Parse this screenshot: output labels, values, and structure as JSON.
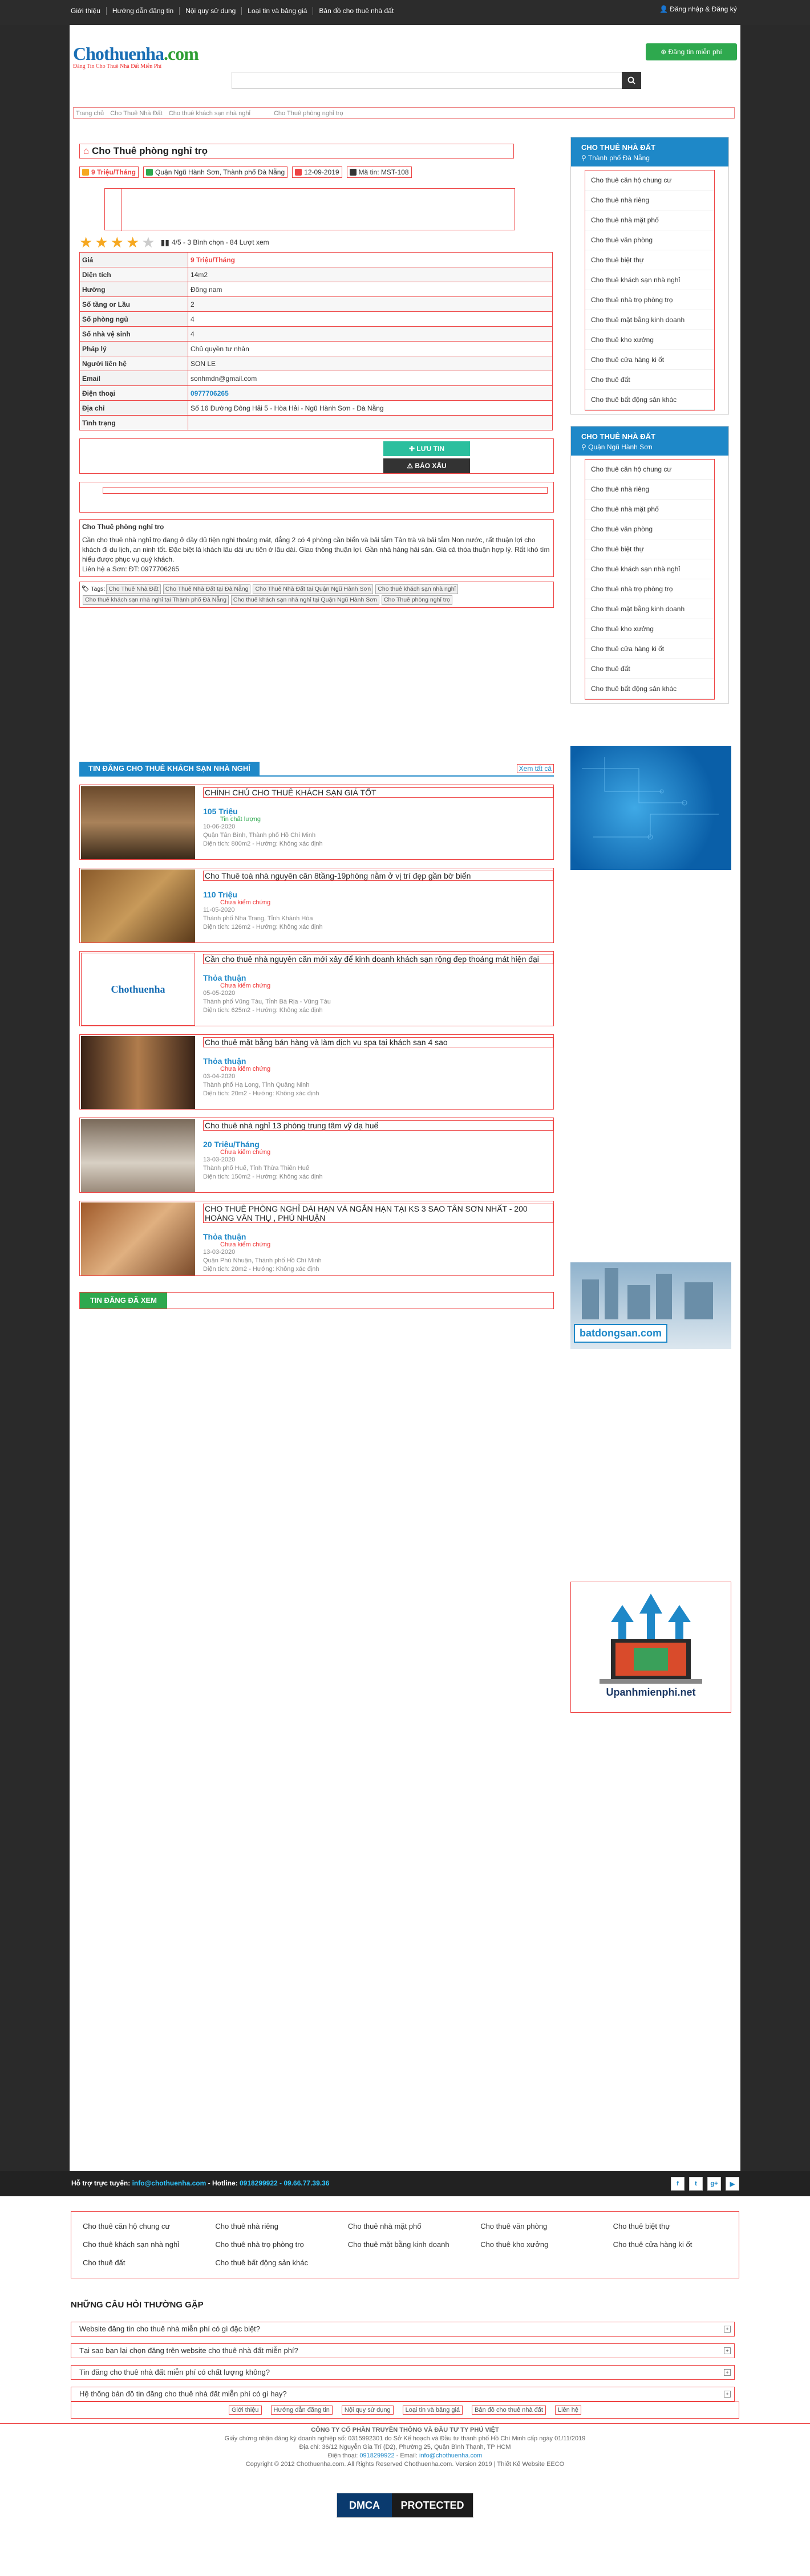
{
  "topbar": {
    "links": [
      "Giới thiệu",
      "Hướng dẫn đăng tin",
      "Nội quy sử dụng",
      "Loại tin và bảng giá",
      "Bản đồ cho thuê nhà đất"
    ],
    "login": "Đăng nhập & Đăng ký"
  },
  "header": {
    "logo_main": "Chothuenha",
    "logo_tld": ".com",
    "logo_slogan": "Đăng Tin Cho Thuê Nhà Đất Miễn Phí",
    "post_button": "Đăng tin miễn phí",
    "search_placeholder": ""
  },
  "breadcrumb": [
    "Trang chủ",
    "Cho Thuê Nhà Đất",
    "Cho thuê khách sạn nhà nghỉ",
    "Cho Thuê phòng nghỉ trọ"
  ],
  "listing": {
    "title": "Cho Thuê phòng nghỉ trọ",
    "price_tag": "9 Triệu/Tháng",
    "location_tag": "Quận Ngũ Hành Sơn, Thành phố Đà Nẵng",
    "date_tag": "12-09-2019",
    "code_tag": "Mã tin: MST-108",
    "rating_text": "4/5 - 3 Bình chọn - 84 Lượt xem",
    "rating_value": 4,
    "info_rows": [
      {
        "label": "Giá",
        "value": "9 Triệu/Tháng"
      },
      {
        "label": "Diện tích",
        "value": "14m2"
      },
      {
        "label": "Hướng",
        "value": "Đông nam"
      },
      {
        "label": "Số tầng or Lầu",
        "value": "2"
      },
      {
        "label": "Số phòng ngủ",
        "value": "4"
      },
      {
        "label": "Số nhà vệ sinh",
        "value": "4"
      },
      {
        "label": "Pháp lý",
        "value": "Chủ quyền tư nhân"
      },
      {
        "label": "Người liên hệ",
        "value": "SON LE"
      },
      {
        "label": "Email",
        "value": "sonhmdn@gmail.com"
      },
      {
        "label": "Điện thoại",
        "value": "0977706265"
      },
      {
        "label": "Địa chỉ",
        "value": "Số 16 Đường Đông Hải 5 - Hòa Hải - Ngũ Hành Sơn - Đà Nẵng"
      },
      {
        "label": "Tình trạng",
        "value": ""
      }
    ],
    "save_button": "LƯU TIN",
    "report_button": "BÁO XẤU",
    "desc_heading": "Cho Thuê phòng nghỉ trọ",
    "description": "Cần cho thuê nhà nghỉ trọ đang ở đầy đủ tiện nghi thoáng mát, đẳng 2 có 4 phòng cần biển và bãi tắm Tân trà và bãi tắm Non nước, rất thuận lợi cho khách đi du lịch, an ninh tốt. Đặc biệt là khách lâu dài ưu tiên ở lâu dài. Giao thông thuận lợi. Gần nhà hàng hải sản. Giá cả thỏa thuận hợp lý. Rất khó tìm hiểu được phục vụ quý khách.",
    "contact": "Liên hệ a Sơn: ĐT: 0977706265",
    "tags_label": "Tags:",
    "tags": [
      "Cho Thuê Nhà Đất",
      "Cho Thuê Nhà Đất tại Đà Nẵng",
      "Cho Thuê Nhà Đất tại Quận Ngũ Hành Sơn",
      "Cho thuê khách sạn nhà nghỉ",
      "Cho thuê khách sạn nhà nghỉ tại Thành phố Đà Nẵng",
      "Cho thuê khách sạn nhà nghỉ tại Quận Ngũ Hành Sơn",
      "Cho Thuê phòng nghỉ trọ"
    ]
  },
  "related": {
    "heading": "TIN ĐĂNG CHO THUÊ KHÁCH SẠN NHÀ NGHỈ",
    "more": "Xem tất cả",
    "items": [
      {
        "title": "CHÍNH CHỦ CHO THUÊ KHÁCH SẠN GIÁ TỐT",
        "price": "105 Triệu",
        "status": "Tin chất lượng",
        "date": "10-06-2020",
        "place": "Quận Tân Bình, Thành phố Hồ Chí Minh",
        "area": "Diện tích: 800m2 - Hướng: Không xác định",
        "thumb": "room"
      },
      {
        "title": "Cho Thuê toà nhà nguyên căn 8tầng-19phòng nằm ở vị trí đẹp gần bờ biển",
        "price": "110 Triệu",
        "status": "Chưa kiểm chứng",
        "date": "11-05-2020",
        "place": "Thành phố Nha Trang, Tỉnh Khánh Hòa",
        "area": "Diện tích: 126m2 - Hướng: Không xác định",
        "thumb": "room2"
      },
      {
        "title": "Cần cho thuê nhà nguyên căn mới xây để kinh doanh khách sạn rộng đẹp thoáng mát hiện đại",
        "price": "Thỏa thuận",
        "status": "Chưa kiểm chứng",
        "date": "05-05-2020",
        "place": "Thành phố Vũng Tàu, Tỉnh Bà Rịa - Vũng Tàu",
        "area": "Diện tích: 625m2 - Hướng: Không xác định",
        "thumb": "logo"
      },
      {
        "title": "Cho thuê mặt bằng bán hàng và làm dịch vụ spa tại khách sạn 4 sao",
        "price": "Thỏa thuận",
        "status": "Chưa kiểm chứng",
        "date": "03-04-2020",
        "place": "Thành phố Hạ Long, Tỉnh Quảng Ninh",
        "area": "Diện tích: 20m2 - Hướng: Không xác định",
        "thumb": "spa"
      },
      {
        "title": "Cho thuê nhà nghỉ 13 phòng trung tâm vỹ dạ huế",
        "price": "20 Triệu/Tháng",
        "status": "Chưa kiểm chứng",
        "date": "13-03-2020",
        "place": "Thành phố Huế, Tỉnh Thừa Thiên Huế",
        "area": "Diện tích: 150m2 - Hướng: Không xác định",
        "thumb": "bed"
      },
      {
        "title": "CHO THUÊ PHÒNG NGHỈ DÀI HẠN VÀ NGẮN HẠN TẠI KS 3 SAO TÂN SƠN NHẤT - 200 HOÀNG VĂN THỤ , PHÚ NHUẬN",
        "price": "Thỏa thuận",
        "status": "Chưa kiểm chứng",
        "date": "13-03-2020",
        "place": "Quận Phú Nhuận, Thành phố Hồ Chí Minh",
        "area": "Diện tích: 20m2 - Hướng: Không xác định",
        "thumb": "room3"
      }
    ],
    "viewed_heading": "TIN ĐĂNG ĐÃ XEM"
  },
  "sidebar": {
    "box1": {
      "title": "CHO THUÊ NHÀ ĐẤT",
      "sub": "Thành phố Đà Nẵng",
      "items": [
        "Cho thuê căn hộ chung cư",
        "Cho thuê nhà riêng",
        "Cho thuê nhà mặt phố",
        "Cho thuê văn phòng",
        "Cho thuê biệt thự",
        "Cho thuê khách sạn nhà nghỉ",
        "Cho thuê nhà trọ phòng trọ",
        "Cho thuê mặt bằng kinh doanh",
        "Cho thuê kho xưởng",
        "Cho thuê cửa hàng ki ốt",
        "Cho thuê đất",
        "Cho thuê bất động sản khác"
      ]
    },
    "box2": {
      "title": "CHO THUÊ NHÀ ĐẤT",
      "sub": "Quận Ngũ Hành Sơn",
      "items": [
        "Cho thuê căn hộ chung cư",
        "Cho thuê nhà riêng",
        "Cho thuê nhà mặt phố",
        "Cho thuê văn phòng",
        "Cho thuê biệt thự",
        "Cho thuê khách sạn nhà nghỉ",
        "Cho thuê nhà trọ phòng trọ",
        "Cho thuê mặt bằng kinh doanh",
        "Cho thuê kho xưởng",
        "Cho thuê cửa hàng ki ốt",
        "Cho thuê đất",
        "Cho thuê bất động sản khác"
      ]
    },
    "ad_batdongsan": "batdongsan.com",
    "ad_upanh": "Upanhmienphi.net"
  },
  "footer": {
    "support_label": "Hỗ trợ trực tuyến:",
    "support_email": "info@chothuenha.com",
    "hotline_label": "- Hotline:",
    "hotline": "0918299922 - 09.66.77.39.36",
    "social": [
      "f",
      "t",
      "g+",
      "▶"
    ],
    "categories": [
      "Cho thuê căn hộ chung cư",
      "Cho thuê nhà riêng",
      "Cho thuê nhà mặt phố",
      "Cho thuê văn phòng",
      "Cho thuê biệt thự",
      "Cho thuê khách sạn nhà nghỉ",
      "Cho thuê nhà trọ phòng trọ",
      "Cho thuê mặt bằng kinh doanh",
      "Cho thuê kho xưởng",
      "Cho thuê cửa hàng ki ốt",
      "Cho thuê đất",
      "Cho thuê bất động sản khác"
    ],
    "faq_heading": "NHỮNG CÂU HỎI THƯỜNG GẶP",
    "faq": [
      "Website đăng tin cho thuê nhà miễn phí có gì đặc biệt?",
      "Tại sao bạn lại chọn đăng trên website cho thuê nhà đất miễn phí?",
      "Tin đăng cho thuê nhà đất miễn phí có chất lượng không?",
      "Hệ thống bản đồ tin đăng cho thuê nhà đất miễn phí có gì hay?"
    ],
    "links": [
      "Giới thiệu",
      "Hướng dẫn đăng tin",
      "Nội quy sử dụng",
      "Loại tin và bảng giá",
      "Bản đồ cho thuê nhà đất",
      "Liên hệ"
    ],
    "company": "CÔNG TY CỔ PHẦN TRUYỀN THÔNG VÀ ĐẦU TƯ TY PHÚ VIỆT",
    "license": "Giấy chứng nhận đăng ký doanh nghiệp số: 0315992301 do Sở Kế hoạch và Đầu tư thành phố Hồ Chí Minh cấp ngày 01/11/2019",
    "address": "Địa chỉ: 36/12 Nguyễn Gia Trí (D2), Phường 25, Quận Bình Thạnh, TP HCM",
    "phone_label": "Điện thoại:",
    "phone": "0918299922",
    "email_label": "- Email:",
    "email": "info@chothuenha.com",
    "copyright": "Copyright © 2012 Chothuenha.com. All Rights Reserved Chothuenha.com. Version 2019 | Thiết Kế Website EECO",
    "dmca_left": "DMCA",
    "dmca_right": "PROTECTED"
  },
  "colors": {
    "accent": "#1e88c8",
    "green": "#2ea94e",
    "red": "#e44444",
    "dark": "#2c2c2c"
  }
}
